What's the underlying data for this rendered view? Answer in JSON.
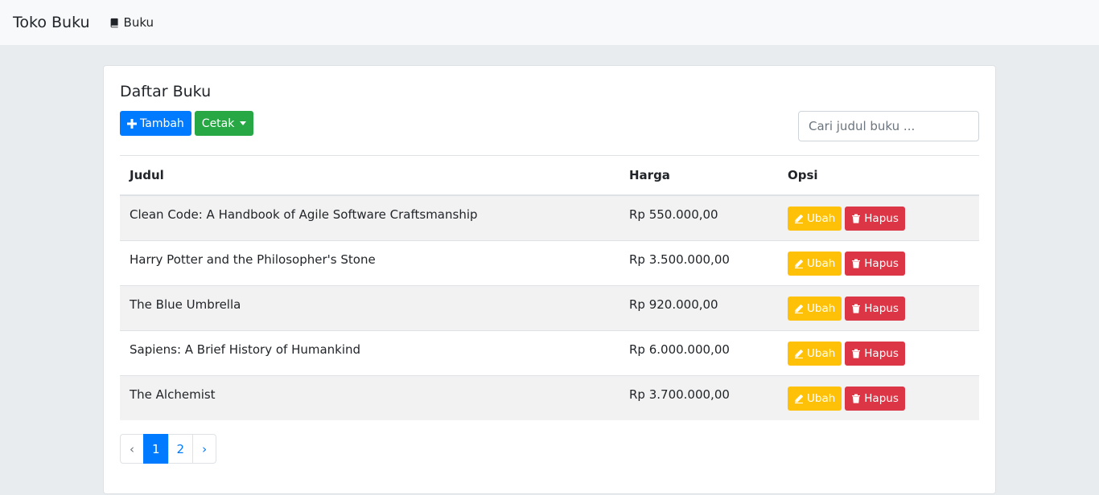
{
  "navbar": {
    "brand": "Toko Buku",
    "links": [
      {
        "label": "Buku",
        "icon": "book-icon"
      }
    ]
  },
  "card": {
    "title": "Daftar Buku",
    "add_button": {
      "label": "Tambah",
      "icon": "plus-icon"
    },
    "print_button": {
      "label": "Cetak"
    },
    "search": {
      "placeholder": "Cari judul buku ...",
      "value": ""
    }
  },
  "table": {
    "headers": {
      "judul": "Judul",
      "harga": "Harga",
      "opsi": "Opsi"
    },
    "rows": [
      {
        "judul": "Clean Code: A Handbook of Agile Software Craftsmanship",
        "harga": "Rp 550.000,00"
      },
      {
        "judul": "Harry Potter and the Philosopher's Stone",
        "harga": "Rp 3.500.000,00"
      },
      {
        "judul": "The Blue Umbrella",
        "harga": "Rp 920.000,00"
      },
      {
        "judul": "Sapiens: A Brief History of Humankind",
        "harga": "Rp 6.000.000,00"
      },
      {
        "judul": "The Alchemist",
        "harga": "Rp 3.700.000,00"
      }
    ],
    "edit_label": "Ubah",
    "delete_label": "Hapus"
  },
  "pagination": {
    "prev": "‹",
    "pages": [
      "1",
      "2"
    ],
    "active": "1",
    "next": "›"
  },
  "colors": {
    "primary": "#007bff",
    "success": "#28a745",
    "warning": "#ffc107",
    "danger": "#dc3545"
  }
}
